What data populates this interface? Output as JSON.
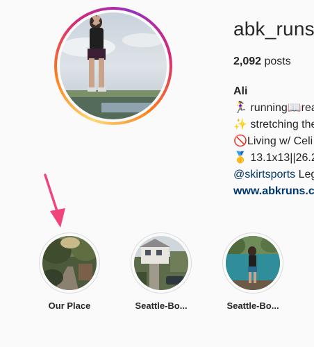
{
  "profile": {
    "username": "abk_runs",
    "posts_count": "2,092",
    "posts_label": " posts",
    "bio": {
      "name": "Ali",
      "line1": "🏃‍♀️ running📖rea",
      "line2": "✨ stretching the",
      "line3": "🚫Living w/ Celi",
      "line4": "🥇 13.1x13||26.2",
      "mention": "@skirtsports",
      "mention_rest": " Leg",
      "link": "www.abkruns.c"
    }
  },
  "highlights": [
    {
      "label": "Our Place"
    },
    {
      "label": "Seattle-Bo..."
    },
    {
      "label": "Seattle-Bo..."
    }
  ],
  "annotation": {
    "arrow_color": "#f0457a"
  },
  "colors": {
    "link": "#00376b",
    "ring_border": "#dbdbdb"
  }
}
